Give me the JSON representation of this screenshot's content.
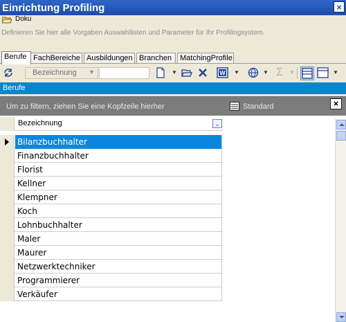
{
  "window": {
    "title": "Einrichtung Profiling"
  },
  "docbar": {
    "label": "Doku",
    "icon": "folder-open-icon"
  },
  "description": "Definieren Sie hier alle Vorgaben Auswahllisten und Parameter für Ihr Profilingsystem.",
  "tabs": [
    {
      "label": "Berufe",
      "active": true
    },
    {
      "label": "FachBereiche"
    },
    {
      "label": "Ausbildungen"
    },
    {
      "label": "Branchen"
    },
    {
      "label": "MatchingProfile"
    }
  ],
  "toolbar": {
    "field_combo": "Bezeichnung",
    "search_value": "",
    "icons": [
      "refresh-icon",
      "new-document-icon",
      "open-folder-icon",
      "delete-icon",
      "word-export-icon",
      "globe-icon",
      "sum-icon",
      "layout-icon",
      "layout-alt-icon"
    ]
  },
  "panel": {
    "title": "Berufe"
  },
  "grid": {
    "group_hint": "Um zu filtern, ziehen Sie eine Kopfzeile hierher",
    "standard_label": "Standard",
    "close_glyph": "×",
    "column": "Bezeichnung",
    "rows": [
      "Bilanzbuchhalter",
      "Finanzbuchhalter",
      "Florist",
      "Kellner",
      "Klempner",
      "Koch",
      "Lohnbuchhalter",
      "Maler",
      "Maurer",
      "Netzwerktechniker",
      "Programmierer",
      "Verkäufer"
    ],
    "selected_index": 0
  },
  "colors": {
    "title_bar": "#1c4ea8",
    "panel_header": "#0a86c8",
    "selection": "#0a86e0",
    "group_bar": "#7c7c7c"
  }
}
